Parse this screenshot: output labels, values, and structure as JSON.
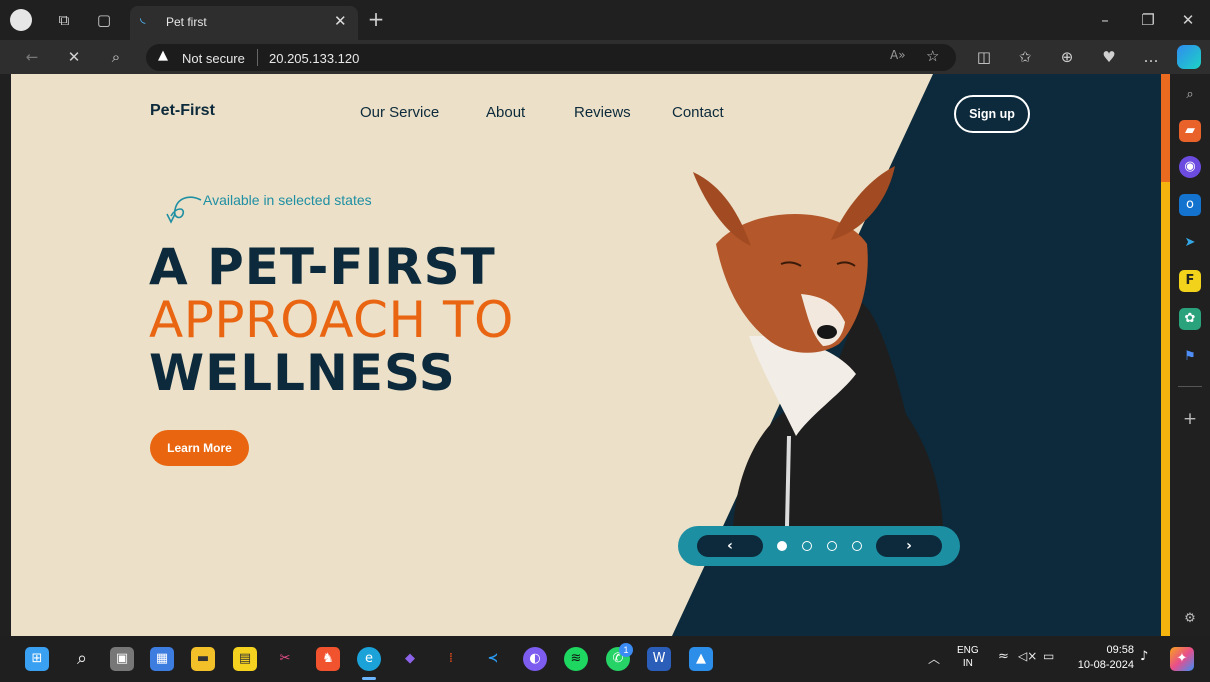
{
  "browser": {
    "tab_title": "Pet first",
    "not_secure_label": "Not secure",
    "url": "20.205.133.120"
  },
  "page": {
    "logo": "Pet-First",
    "nav": [
      "Our Service",
      "About",
      "Reviews",
      "Contact"
    ],
    "signup_label": "Sign up",
    "availability": "Available in selected states",
    "hero_line1": "A PET-FIRST",
    "hero_line2": "APPROACH TO",
    "hero_line3": "WELLNESS",
    "cta_label": "Learn More",
    "slider": {
      "prev": "‹",
      "next": "›",
      "slides": 4,
      "active": 1
    },
    "colors": {
      "navy": "#0c2a3b",
      "orange": "#e9650f",
      "cream": "#ece0c8",
      "teal": "#1d8fa3"
    }
  },
  "taskbar": {
    "language": "ENG",
    "region": "IN",
    "time": "09:58",
    "date": "10-08-2024",
    "whatsapp_badge": "1"
  }
}
